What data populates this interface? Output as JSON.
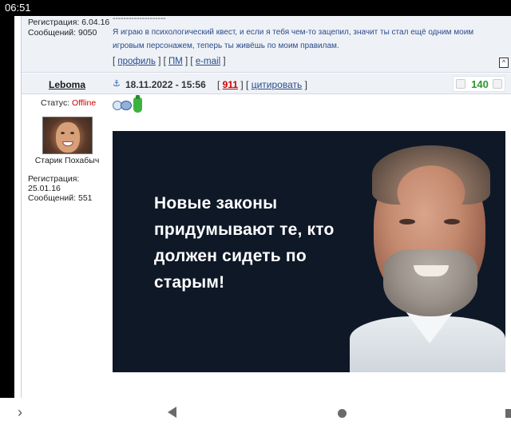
{
  "status_bar": {
    "time": "06:51"
  },
  "prev_post": {
    "registration": "Регистрация: 6.04.16",
    "messages": "Сообщений: 9050",
    "sig_line": "--------------------",
    "signature": "Я играю в психологический квест, и если я тебя чем-то зацепил, значит ты стал ещё одним моим игровым персонажем, теперь ты живёшь по моим правилам.",
    "links": {
      "profile": "профиль",
      "pm": "ПМ",
      "email": "e-mail"
    },
    "up_icon": "^"
  },
  "post": {
    "username": "Leboma",
    "date": "18.11.2022 - 15:56",
    "number": "911",
    "quote": "цитировать",
    "rating": "140",
    "anchor_icon": "anchor-icon"
  },
  "user": {
    "status_label": "Статус:",
    "status_value": "Offline",
    "title": "Старик Похабыч",
    "registration_label": "Регистрация:",
    "registration_date": "25.01.16",
    "messages": "Сообщений: 551"
  },
  "image": {
    "caption": "Новые законы придумывают те, кто должен сидеть по старым!"
  },
  "nav": {
    "icons": [
      "chevron-right-icon",
      "back-icon",
      "home-icon",
      "recent-icon"
    ]
  }
}
